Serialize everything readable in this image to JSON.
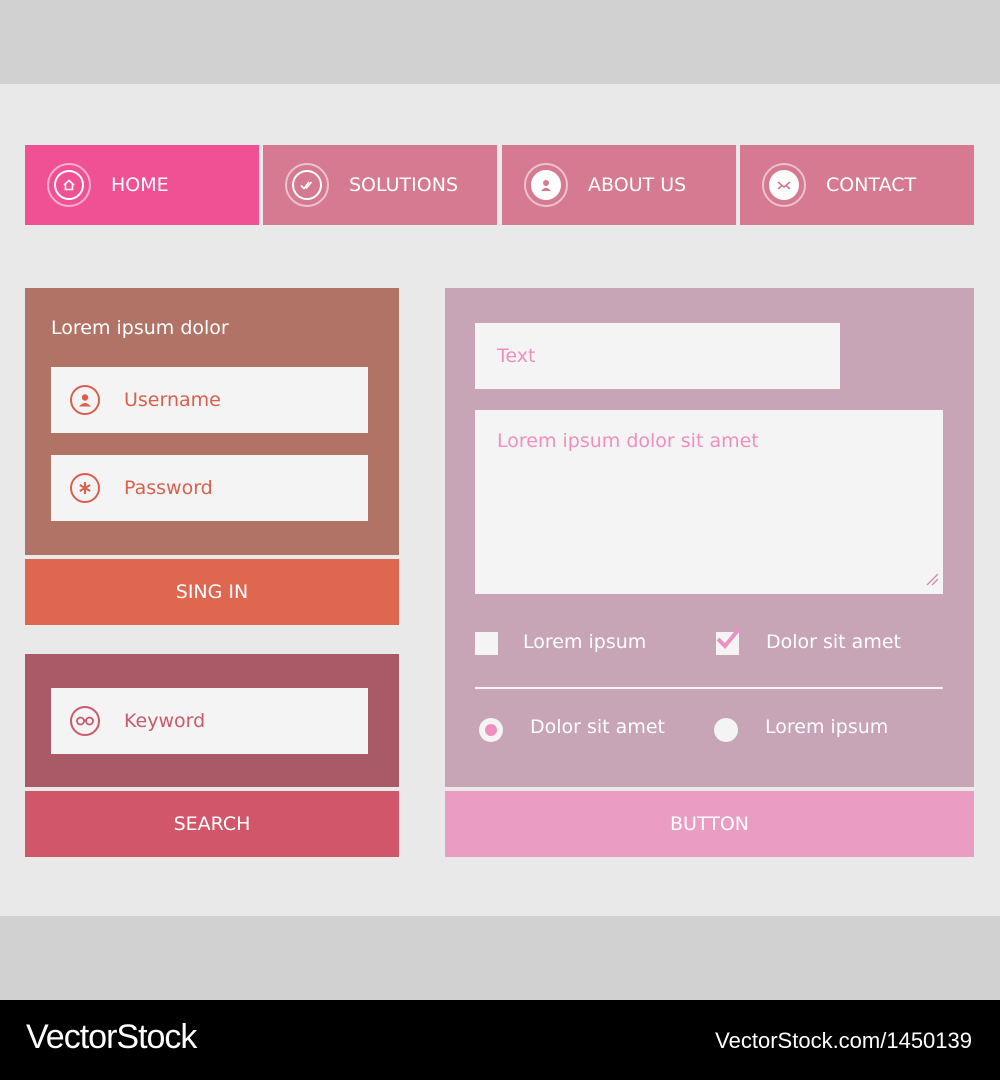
{
  "colors": {
    "nav_active": "#f05195",
    "nav_inactive": "#d57a90",
    "login_panel": "#b27367",
    "signin_button": "#df6750",
    "search_panel": "#aa5966",
    "search_button": "#d25669",
    "form_panel": "#c7a4b6",
    "form_button": "#eb9cc2",
    "placeholder": "#ef8fbf",
    "field_text": "#d9604d"
  },
  "nav": {
    "items": [
      {
        "label": "HOME",
        "icon": "home-icon",
        "active": true
      },
      {
        "label": "SOLUTIONS",
        "icon": "check-icon",
        "active": false
      },
      {
        "label": "ABOUT US",
        "icon": "user-icon",
        "active": false
      },
      {
        "label": "CONTACT",
        "icon": "mail-icon",
        "active": false
      }
    ]
  },
  "login": {
    "title": "Lorem ipsum dolor",
    "username_placeholder": "Username",
    "password_placeholder": "Password",
    "submit_label": "SING IN"
  },
  "search": {
    "placeholder": "Keyword",
    "button_label": "SEARCH"
  },
  "form": {
    "text_placeholder": "Text",
    "textarea_placeholder": "Lorem ipsum dolor sit amet",
    "checkboxes": [
      {
        "label": "Lorem ipsum",
        "checked": false
      },
      {
        "label": "Dolor sit amet",
        "checked": true
      }
    ],
    "radios": [
      {
        "label": "Dolor sit amet",
        "selected": true
      },
      {
        "label": "Lorem ipsum",
        "selected": false
      }
    ],
    "button_label": "BUTTON"
  },
  "footer": {
    "brand": "VectorStock",
    "image_ref": "VectorStock.com/1450139"
  }
}
